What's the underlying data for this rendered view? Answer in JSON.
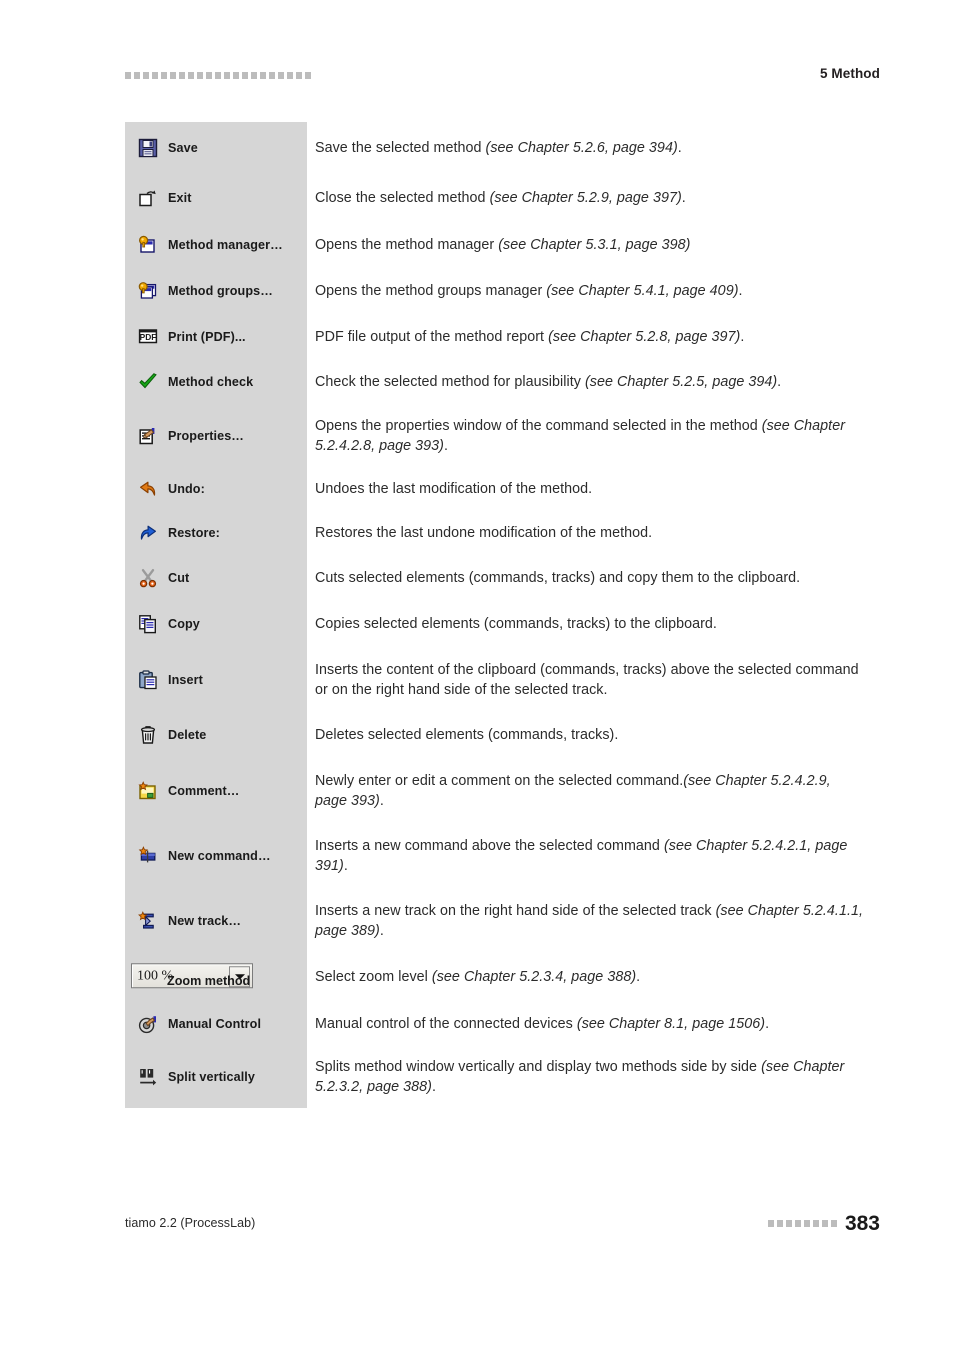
{
  "header": {
    "title": "5 Method",
    "decorative_squares": 21
  },
  "footer": {
    "product": "tiamo 2.2 (ProcessLab)",
    "page_number": "383",
    "decorative_squares": 8
  },
  "zoom_control": {
    "value": "100 %",
    "arrow_icon": "chevron-down-icon"
  },
  "colors": {
    "panel_background": "#d6d6d6",
    "page_background": "#ffffff",
    "text": "#2b2b2b",
    "decoration": "#bcbcbc"
  },
  "rows": [
    {
      "icon": "save-floppy-icon",
      "label": "Save",
      "desc_plain": "Save the selected method ",
      "desc_italic": "(see Chapter 5.2.6, page 394)",
      "desc_tail": "."
    },
    {
      "icon": "exit-open-folder-icon",
      "label": "Exit",
      "desc_plain": "Close the selected method ",
      "desc_italic": "(see Chapter 5.2.9, page 397)",
      "desc_tail": "."
    },
    {
      "icon": "method-manager-icon",
      "label": "Method manager…",
      "desc_plain": "Opens the method manager ",
      "desc_italic": "(see Chapter 5.3.1, page 398)",
      "desc_tail": ""
    },
    {
      "icon": "method-groups-icon",
      "label": "Method groups…",
      "desc_plain": "Opens the method groups manager ",
      "desc_italic": "(see Chapter 5.4.1, page 409)",
      "desc_tail": "."
    },
    {
      "icon": "pdf-print-icon",
      "label": "Print (PDF)...",
      "desc_plain": "PDF file output of the method report ",
      "desc_italic": "(see Chapter 5.2.8, page 397)",
      "desc_tail": "."
    },
    {
      "icon": "green-check-icon",
      "label": "Method check",
      "desc_plain": "Check the selected method for plausibility ",
      "desc_italic": "(see Chapter 5.2.5, page 394)",
      "desc_tail": "."
    },
    {
      "icon": "properties-icon",
      "label": "Properties…",
      "desc_plain": "Opens the properties window of the command selected in the method ",
      "desc_italic": "(see Chapter 5.2.4.2.8, page 393)",
      "desc_tail": "."
    },
    {
      "icon": "undo-arrow-icon",
      "label": "Undo:",
      "desc_plain": "Undoes the last modification of the method.",
      "desc_italic": "",
      "desc_tail": ""
    },
    {
      "icon": "redo-arrow-icon",
      "label": "Restore:",
      "desc_plain": "Restores the last undone modification of the method.",
      "desc_italic": "",
      "desc_tail": ""
    },
    {
      "icon": "cut-scissors-icon",
      "label": "Cut",
      "desc_plain": "Cuts selected elements (commands, tracks) and copy them to the clipboard.",
      "desc_italic": "",
      "desc_tail": ""
    },
    {
      "icon": "copy-icon",
      "label": "Copy",
      "desc_plain": "Copies selected elements (commands, tracks) to the clipboard.",
      "desc_italic": "",
      "desc_tail": ""
    },
    {
      "icon": "paste-clipboard-icon",
      "label": "Insert",
      "desc_plain": "Inserts the content of the clipboard (commands, tracks) above the selected command or on the right hand side of the selected track.",
      "desc_italic": "",
      "desc_tail": ""
    },
    {
      "icon": "delete-trash-icon",
      "label": "Delete",
      "desc_plain": "Deletes selected elements (commands, tracks).",
      "desc_italic": "",
      "desc_tail": ""
    },
    {
      "icon": "comment-note-icon",
      "label": "Comment…",
      "desc_plain": "Newly enter or edit a comment on the selected command.",
      "desc_italic": "(see Chapter 5.2.4.2.9, page 393)",
      "desc_tail": "."
    },
    {
      "icon": "new-command-icon",
      "label": "New command…",
      "desc_plain": "Inserts a new command above the selected command ",
      "desc_italic": "(see Chapter 5.2.4.2.1, page 391)",
      "desc_tail": "."
    },
    {
      "icon": "new-track-icon",
      "label": "New track…",
      "desc_plain": "Inserts a new track on the right hand side of the selected track ",
      "desc_italic": "(see Chapter 5.2.4.1.1, page 389)",
      "desc_tail": "."
    },
    {
      "icon": "zoom-combobox",
      "label": "Zoom method",
      "desc_plain": "Select zoom level ",
      "desc_italic": "(see Chapter 5.2.3.4, page 388)",
      "desc_tail": "."
    },
    {
      "icon": "manual-control-icon",
      "label": "Manual Control",
      "desc_plain": "Manual control of the connected devices ",
      "desc_italic": "(see Chapter 8.1, page 1506)",
      "desc_tail": "."
    },
    {
      "icon": "split-vertically-icon",
      "label": "Split vertically",
      "desc_plain": "Splits method window vertically and display two methods side by side ",
      "desc_italic": "(see Chapter 5.2.3.2, page 388)",
      "desc_tail": "."
    }
  ]
}
